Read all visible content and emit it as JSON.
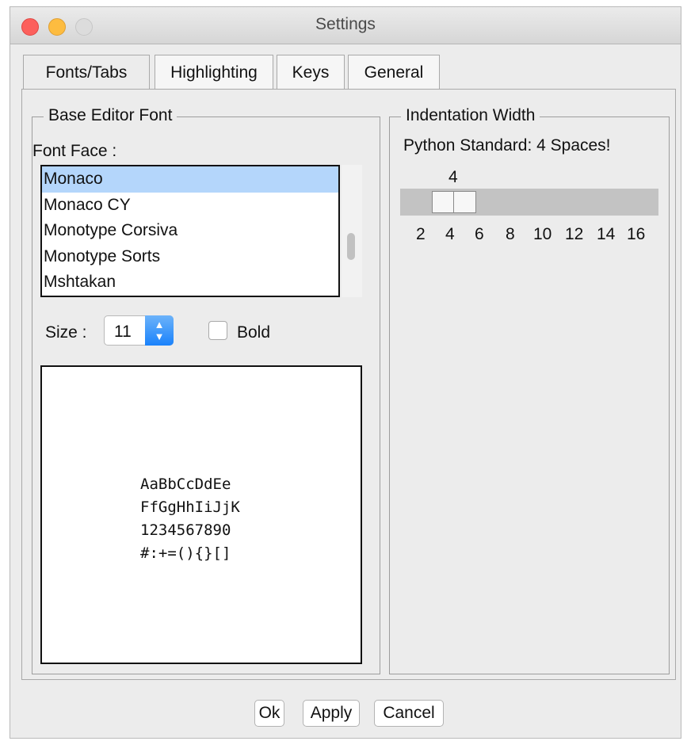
{
  "window": {
    "title": "Settings"
  },
  "tabs": [
    {
      "label": "Fonts/Tabs",
      "active": true
    },
    {
      "label": "Highlighting",
      "active": false
    },
    {
      "label": "Keys",
      "active": false
    },
    {
      "label": "General",
      "active": false
    }
  ],
  "font_group": {
    "title": "Base Editor Font",
    "font_face_label": "Font Face :",
    "fonts": [
      "Monaco",
      "Monaco CY",
      "Monotype Corsiva",
      "Monotype Sorts",
      "Mshtakan"
    ],
    "selected_font": "Monaco",
    "size_label": "Size :",
    "size_value": "11",
    "bold_label": "Bold",
    "bold_checked": false,
    "preview_lines": [
      "AaBbCcDdEe",
      "FfGgHhIiJjK",
      "1234567890",
      "#:+=(){}[]"
    ]
  },
  "indent_group": {
    "title": "Indentation Width",
    "note": "Python Standard: 4 Spaces!",
    "value": "4",
    "ticks": [
      "2",
      "4",
      "6",
      "8",
      "10",
      "12",
      "14",
      "16"
    ]
  },
  "buttons": {
    "ok": "Ok",
    "apply": "Apply",
    "cancel": "Cancel"
  },
  "colors": {
    "selection": "#b4d6fb",
    "close": "#fc605c",
    "minimize": "#fdbc40",
    "accent": "#1a82fb"
  }
}
